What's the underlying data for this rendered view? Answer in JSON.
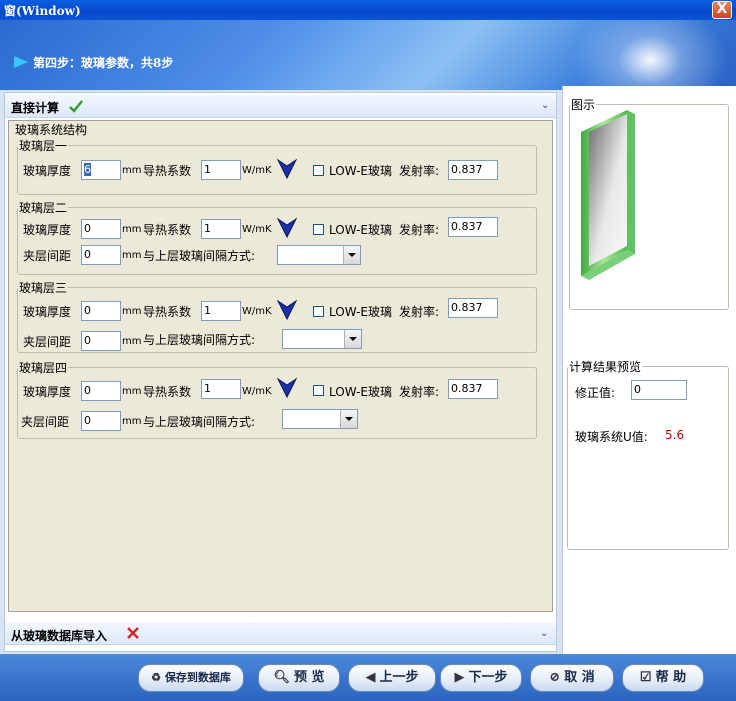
{
  "window": {
    "title": "窗(Window)",
    "close_label": "X"
  },
  "header": {
    "step_text": "第四步：玻璃参数，共8步"
  },
  "sections": {
    "direct_calc": {
      "label": "直接计算"
    },
    "db_import": {
      "label": "从玻璃数据库导入"
    }
  },
  "structure": {
    "group_title": "玻璃系统结构",
    "layers": [
      {
        "title": "玻璃层一",
        "thickness_label": "玻璃厚度",
        "thickness": "6",
        "thickness_unit": "mm",
        "conductivity_label": "导热系数",
        "conductivity": "1",
        "conductivity_unit": "W/mK",
        "lowe_label": "LOW-E玻璃",
        "emissivity_label": "发射率:",
        "emissivity": "0.837"
      },
      {
        "title": "玻璃层二",
        "thickness_label": "玻璃厚度",
        "thickness": "0",
        "thickness_unit": "mm",
        "conductivity_label": "导热系数",
        "conductivity": "1",
        "conductivity_unit": "W/mK",
        "lowe_label": "LOW-E玻璃",
        "emissivity_label": "发射率:",
        "emissivity": "0.837",
        "gap_label": "夹层间距",
        "gap": "0",
        "gap_unit": "mm",
        "gap_mode_label": "与上层玻璃间隔方式:"
      },
      {
        "title": "玻璃层三",
        "thickness_label": "玻璃厚度",
        "thickness": "0",
        "thickness_unit": "mm",
        "conductivity_label": "导热系数",
        "conductivity": "1",
        "conductivity_unit": "W/mK",
        "lowe_label": "LOW-E玻璃",
        "emissivity_label": "发射率:",
        "emissivity": "0.837",
        "gap_label": "夹层间距",
        "gap": "0",
        "gap_unit": "mm",
        "gap_mode_label": "与上层玻璃间隔方式:"
      },
      {
        "title": "玻璃层四",
        "thickness_label": "玻璃厚度",
        "thickness": "0",
        "thickness_unit": "mm",
        "conductivity_label": "导热系数",
        "conductivity": "1",
        "conductivity_unit": "W/mK",
        "lowe_label": "LOW-E玻璃",
        "emissivity_label": "发射率:",
        "emissivity": "0.837",
        "gap_label": "夹层间距",
        "gap": "0",
        "gap_unit": "mm",
        "gap_mode_label": "与上层玻璃间隔方式:"
      }
    ]
  },
  "preview": {
    "title": "图示"
  },
  "results": {
    "title": "计算结果预览",
    "correction_label": "修正值:",
    "correction_value": "0",
    "u_label": "玻璃系统U值:",
    "u_value": "5.6",
    "u_color": "#c00000"
  },
  "footer": {
    "save": "保存到数据库",
    "preview": "预 览",
    "prev": "上一步",
    "next": "下一步",
    "cancel": "取 消",
    "help": "帮 助"
  },
  "colors": {
    "check": "#2aa02a",
    "cross": "#e02020",
    "accent": "#316ac5"
  }
}
